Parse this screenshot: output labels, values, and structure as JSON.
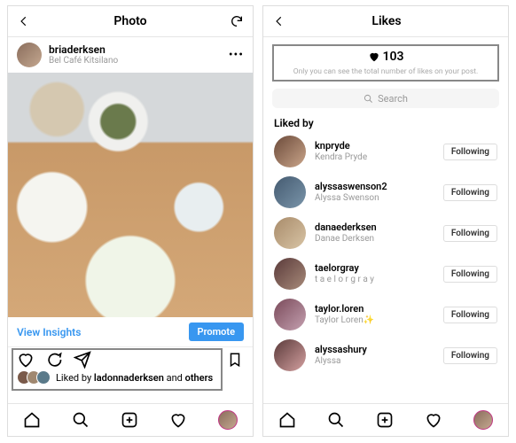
{
  "left": {
    "header_title": "Photo",
    "author_username": "briaderksen",
    "author_location": "Bel Café Kitsilano",
    "view_insights": "View Insights",
    "promote": "Promote",
    "likes_prefix": "Liked by ",
    "likes_bold": "ladonnaderksen",
    "likes_suffix": " and ",
    "likes_others": "others"
  },
  "right": {
    "header_title": "Likes",
    "like_count": "103",
    "like_note": "Only you can see the total number of likes on your post.",
    "search_placeholder": "Search",
    "liked_by": "Liked by",
    "likers": [
      {
        "username": "knpryde",
        "display": "Kendra Pryde",
        "av": "linear-gradient(135deg,#6b4a3a,#caa58a)"
      },
      {
        "username": "alyssaswenson2",
        "display": "Alyssa Swenson",
        "av": "linear-gradient(135deg,#445a70,#7a95aa)"
      },
      {
        "username": "danaederksen",
        "display": "Danae Derksen",
        "av": "linear-gradient(135deg,#a88b6a,#d8c4a5)"
      },
      {
        "username": "taelorgray",
        "display": "t a e l o r  g r a y",
        "av": "linear-gradient(135deg,#5a3a3a,#a88b7a)"
      },
      {
        "username": "taylor.loren",
        "display": "Taylor Loren✨",
        "av": "linear-gradient(135deg,#7a4a5a,#c4a0b0)"
      },
      {
        "username": "alyssashury",
        "display": "Alyssa",
        "av": "linear-gradient(135deg,#5a3a3a,#d4a0a0)"
      }
    ],
    "following": "Following"
  }
}
